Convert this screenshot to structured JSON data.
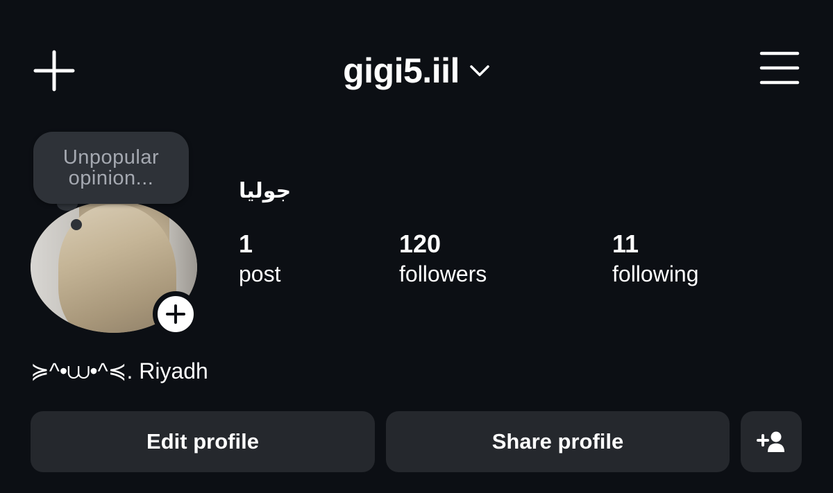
{
  "header": {
    "username": "gigi5.iil",
    "icons": {
      "new_post": "plus-icon",
      "account_switch": "chevron-down-icon",
      "menu": "hamburger-menu-icon"
    }
  },
  "note": {
    "line1": "Unpopular",
    "line2": "opinion..."
  },
  "profile": {
    "display_name": "جوليا",
    "avatar_add_icon": "plus-icon",
    "bio": "≽^•⩊•^≼. Riyadh"
  },
  "stats": {
    "posts": {
      "count": "1",
      "label": "post"
    },
    "followers": {
      "count": "120",
      "label": "followers"
    },
    "following": {
      "count": "11",
      "label": "following"
    }
  },
  "actions": {
    "edit_profile": "Edit profile",
    "share_profile": "Share profile",
    "discover_people_icon": "add-person-icon"
  },
  "colors": {
    "background": "#0c0f14",
    "button": "#25282d",
    "note_bubble": "#2e3238",
    "note_text": "#a5a9b1"
  }
}
